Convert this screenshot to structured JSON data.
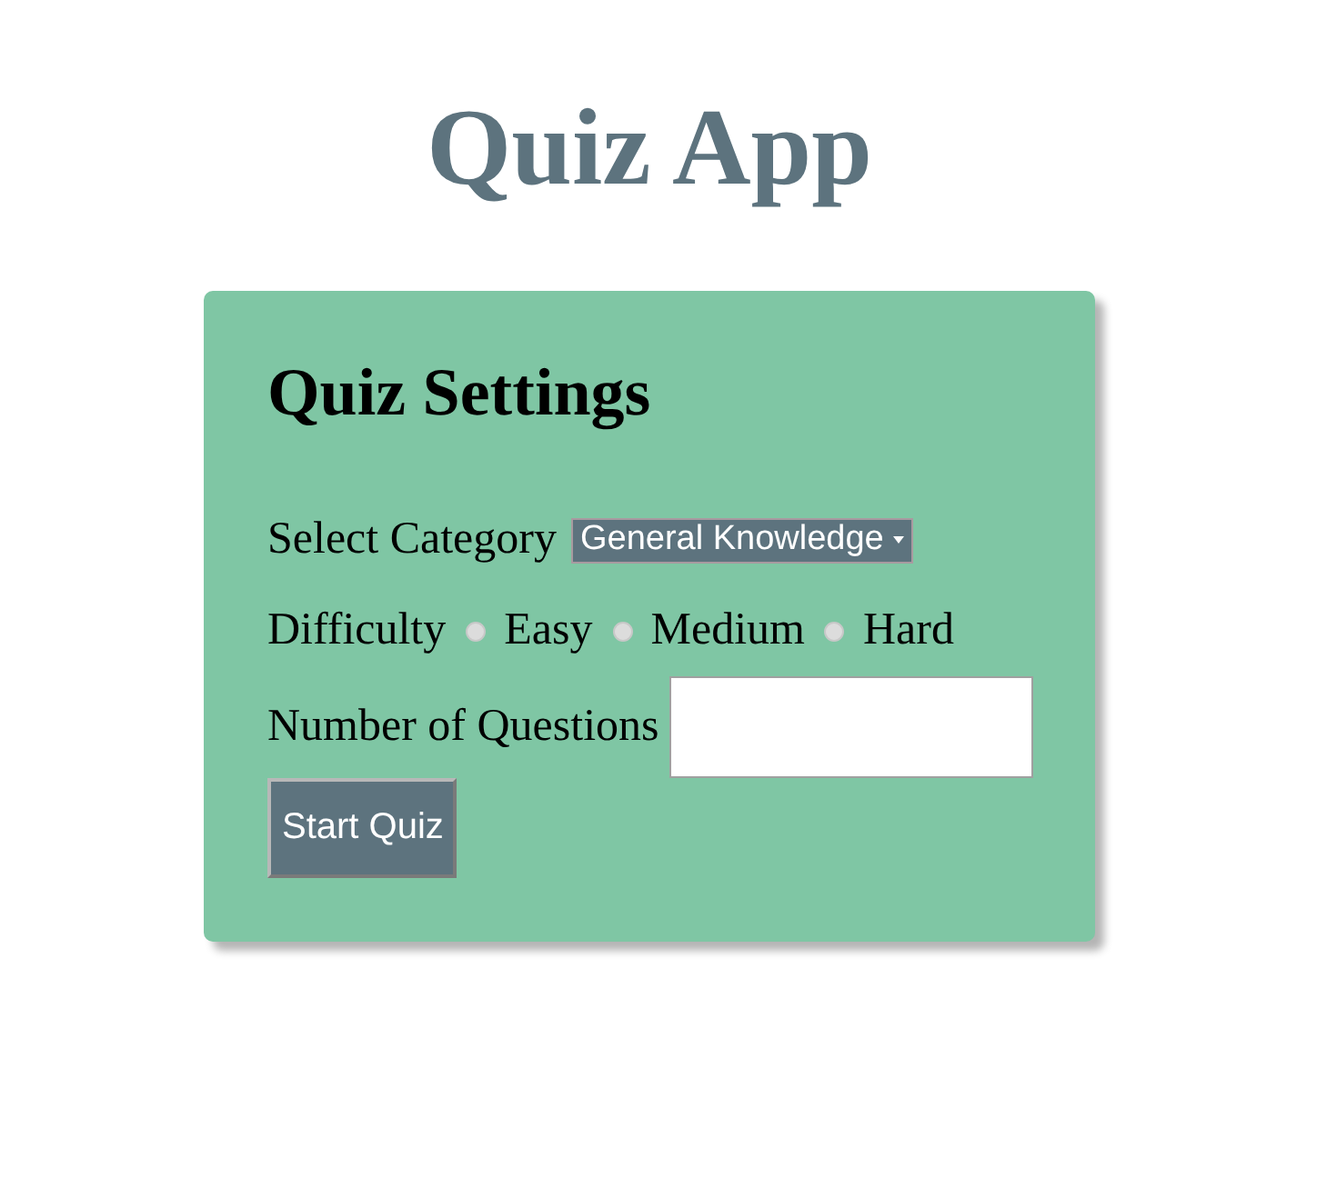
{
  "title": "Quiz App",
  "settings": {
    "heading": "Quiz Settings",
    "category": {
      "label": "Select Category",
      "value": "General Knowledge"
    },
    "difficulty": {
      "label": "Difficulty",
      "options": [
        {
          "label": "Easy",
          "selected": false
        },
        {
          "label": "Medium",
          "selected": false
        },
        {
          "label": "Hard",
          "selected": false
        }
      ]
    },
    "questions": {
      "label": "Number of Questions"
    },
    "start_button": "Start Quiz"
  }
}
